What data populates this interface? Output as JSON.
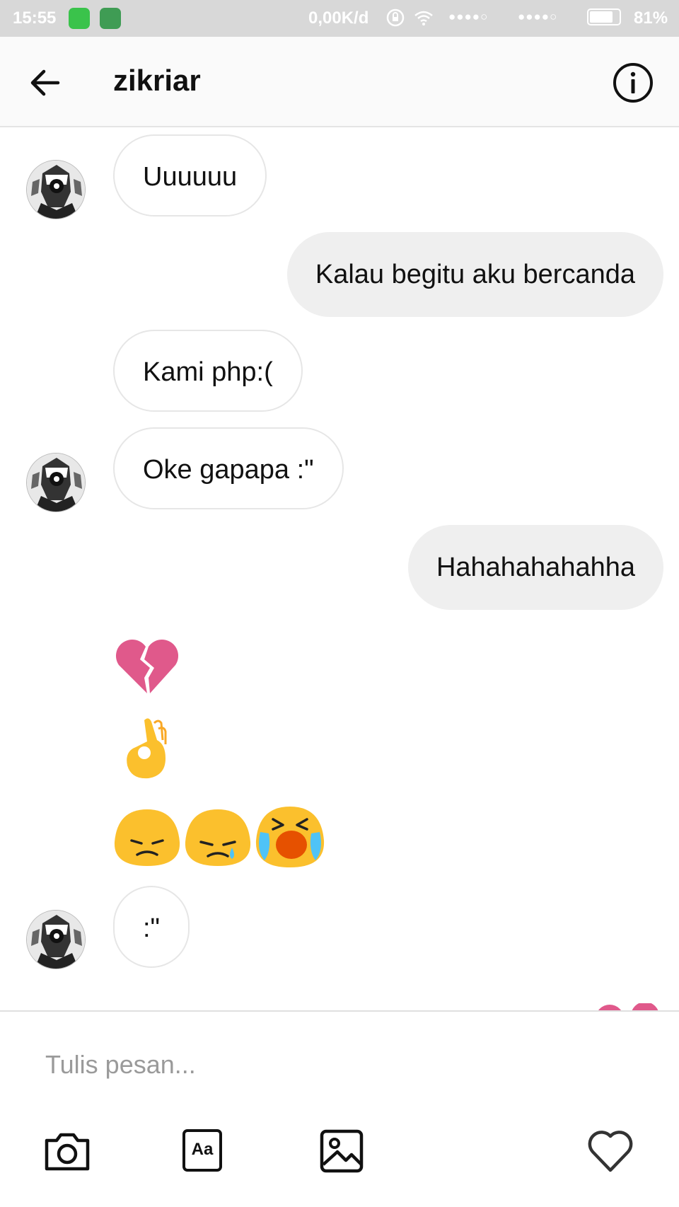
{
  "status_bar": {
    "time": "15:55",
    "network_speed": "0,00K/d",
    "signal_1": "●●●●○",
    "signal_2": "●●●●○",
    "battery_percent": "81%",
    "battery_level": 0.81
  },
  "header": {
    "contact_name": "zikriar",
    "back_icon": "arrow-left-icon",
    "info_icon": "info-icon"
  },
  "messages": [
    {
      "side": "in",
      "text": "Uuuuuu"
    },
    {
      "side": "out",
      "text": "Kalau begitu aku bercanda"
    },
    {
      "side": "in",
      "text": "Kami php:("
    },
    {
      "side": "in",
      "text": "Oke gapapa :\""
    },
    {
      "side": "out",
      "text": "Hahahahahahha"
    },
    {
      "side": "in",
      "emoji": "broken-heart"
    },
    {
      "side": "in",
      "emoji": "ok-hand"
    },
    {
      "side": "in",
      "emoji": [
        "pensive-face",
        "crying-face",
        "loudly-crying-face"
      ]
    },
    {
      "side": "in",
      "text": ":\""
    },
    {
      "side": "out",
      "emoji": "two-hearts"
    }
  ],
  "composer": {
    "placeholder": "Tulis pesan...",
    "tools": [
      "camera-icon",
      "text-style-icon",
      "gallery-icon",
      "heart-icon"
    ],
    "text_style_label": "Aa"
  },
  "colors": {
    "outgoing_bubble": "#efefef",
    "incoming_border": "#e6e6e6",
    "emoji_yellow": "#fbc02d",
    "heart_pink": "#e0598b"
  }
}
